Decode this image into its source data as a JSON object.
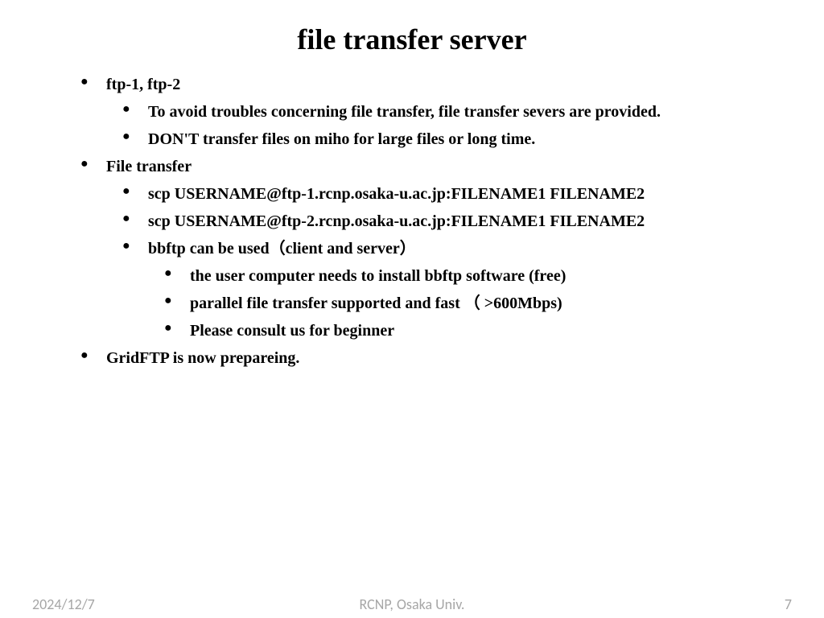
{
  "title": "file transfer server",
  "bullets": {
    "l1_0": "ftp-1, ftp-2",
    "l1_0_l2_0": "To avoid troubles concerning file transfer, file transfer severs are provided.",
    "l1_0_l2_1": "DON'T transfer files on miho for large files or long time.",
    "l1_1": "File transfer",
    "l1_1_l2_0": "scp  USERNAME@ftp-1.rcnp.osaka-u.ac.jp:FILENAME1  FILENAME2",
    "l1_1_l2_1": "scp  USERNAME@ftp-2.rcnp.osaka-u.ac.jp:FILENAME1  FILENAME2",
    "l1_1_l2_2": "bbftp can be used（client and server）",
    "l1_1_l2_2_l3_0": "the user computer needs to install bbftp software (free)",
    "l1_1_l2_2_l3_1": "parallel file transfer supported and fast （ >600Mbps)",
    "l1_1_l2_2_l3_2": "Please consult us for beginner",
    "l1_2": "GridFTP is now prepareing."
  },
  "footer": {
    "date": "2024/12/7",
    "org": "RCNP, Osaka Univ.",
    "page": "7"
  }
}
